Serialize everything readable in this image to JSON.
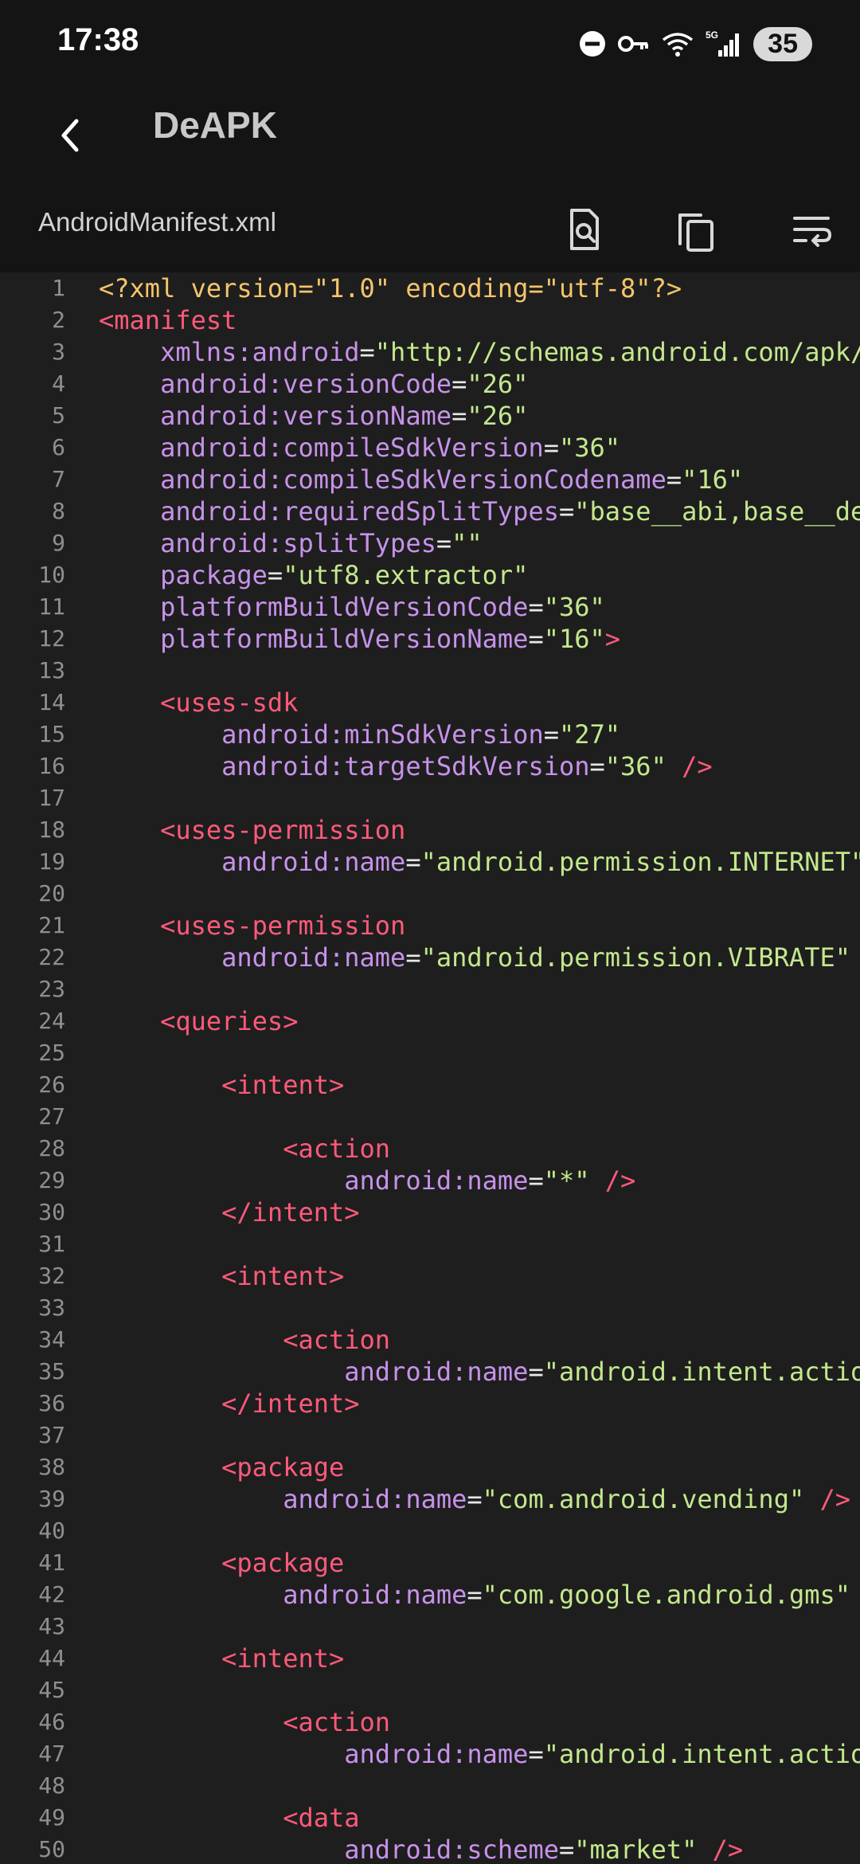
{
  "status_bar": {
    "time": "17:38",
    "battery": "35"
  },
  "app_bar": {
    "title": "DeAPK"
  },
  "file_bar": {
    "filename": "AndroidManifest.xml"
  },
  "icons": {
    "back": "back-arrow-icon",
    "search": "search-document-icon",
    "copy": "copy-icon",
    "wrap": "wrap-text-icon"
  },
  "colors": {
    "tag": "#ff5a7a",
    "attribute": "#c792ea",
    "value": "#c3e88d",
    "declaration": "#f5c56b",
    "line_number": "#8f8f8f"
  },
  "code": [
    {
      "n": "1",
      "segs": [
        [
          "decl",
          "<?xml version=\"1.0\" encoding=\"utf-8\"?>"
        ]
      ]
    },
    {
      "n": "2",
      "segs": [
        [
          "tag",
          "<manifest"
        ]
      ]
    },
    {
      "n": "3",
      "segs": [
        [
          "sp",
          "    "
        ],
        [
          "attr",
          "xmlns:android"
        ],
        [
          "eq",
          "="
        ],
        [
          "val",
          "\"http://schemas.android.com/apk/res/android\""
        ]
      ]
    },
    {
      "n": "4",
      "segs": [
        [
          "sp",
          "    "
        ],
        [
          "attr",
          "android:versionCode"
        ],
        [
          "eq",
          "="
        ],
        [
          "val",
          "\"26\""
        ]
      ]
    },
    {
      "n": "5",
      "segs": [
        [
          "sp",
          "    "
        ],
        [
          "attr",
          "android:versionName"
        ],
        [
          "eq",
          "="
        ],
        [
          "val",
          "\"26\""
        ]
      ]
    },
    {
      "n": "6",
      "segs": [
        [
          "sp",
          "    "
        ],
        [
          "attr",
          "android:compileSdkVersion"
        ],
        [
          "eq",
          "="
        ],
        [
          "val",
          "\"36\""
        ]
      ]
    },
    {
      "n": "7",
      "segs": [
        [
          "sp",
          "    "
        ],
        [
          "attr",
          "android:compileSdkVersionCodename"
        ],
        [
          "eq",
          "="
        ],
        [
          "val",
          "\"16\""
        ]
      ]
    },
    {
      "n": "8",
      "segs": [
        [
          "sp",
          "    "
        ],
        [
          "attr",
          "android:requiredSplitTypes"
        ],
        [
          "eq",
          "="
        ],
        [
          "val",
          "\"base__abi,base__density\""
        ]
      ]
    },
    {
      "n": "9",
      "segs": [
        [
          "sp",
          "    "
        ],
        [
          "attr",
          "android:splitTypes"
        ],
        [
          "eq",
          "="
        ],
        [
          "val",
          "\"\""
        ]
      ]
    },
    {
      "n": "10",
      "segs": [
        [
          "sp",
          "    "
        ],
        [
          "attr",
          "package"
        ],
        [
          "eq",
          "="
        ],
        [
          "val",
          "\"utf8.extractor\""
        ]
      ]
    },
    {
      "n": "11",
      "segs": [
        [
          "sp",
          "    "
        ],
        [
          "attr",
          "platformBuildVersionCode"
        ],
        [
          "eq",
          "="
        ],
        [
          "val",
          "\"36\""
        ]
      ]
    },
    {
      "n": "12",
      "segs": [
        [
          "sp",
          "    "
        ],
        [
          "attr",
          "platformBuildVersionName"
        ],
        [
          "eq",
          "="
        ],
        [
          "val",
          "\"16\""
        ],
        [
          "tag",
          ">"
        ]
      ]
    },
    {
      "n": "13",
      "segs": []
    },
    {
      "n": "14",
      "segs": [
        [
          "sp",
          "    "
        ],
        [
          "tag",
          "<uses-sdk"
        ]
      ]
    },
    {
      "n": "15",
      "segs": [
        [
          "sp",
          "        "
        ],
        [
          "attr",
          "android:minSdkVersion"
        ],
        [
          "eq",
          "="
        ],
        [
          "val",
          "\"27\""
        ]
      ]
    },
    {
      "n": "16",
      "segs": [
        [
          "sp",
          "        "
        ],
        [
          "attr",
          "android:targetSdkVersion"
        ],
        [
          "eq",
          "="
        ],
        [
          "val",
          "\"36\""
        ],
        [
          "tag",
          " />"
        ]
      ]
    },
    {
      "n": "17",
      "segs": []
    },
    {
      "n": "18",
      "segs": [
        [
          "sp",
          "    "
        ],
        [
          "tag",
          "<uses-permission"
        ]
      ]
    },
    {
      "n": "19",
      "segs": [
        [
          "sp",
          "        "
        ],
        [
          "attr",
          "android:name"
        ],
        [
          "eq",
          "="
        ],
        [
          "val",
          "\"android.permission.INTERNET\""
        ],
        [
          "tag",
          " />"
        ]
      ]
    },
    {
      "n": "20",
      "segs": []
    },
    {
      "n": "21",
      "segs": [
        [
          "sp",
          "    "
        ],
        [
          "tag",
          "<uses-permission"
        ]
      ]
    },
    {
      "n": "22",
      "segs": [
        [
          "sp",
          "        "
        ],
        [
          "attr",
          "android:name"
        ],
        [
          "eq",
          "="
        ],
        [
          "val",
          "\"android.permission.VIBRATE\""
        ],
        [
          "tag",
          " />"
        ]
      ]
    },
    {
      "n": "23",
      "segs": []
    },
    {
      "n": "24",
      "segs": [
        [
          "sp",
          "    "
        ],
        [
          "tag",
          "<queries>"
        ]
      ]
    },
    {
      "n": "25",
      "segs": []
    },
    {
      "n": "26",
      "segs": [
        [
          "sp",
          "        "
        ],
        [
          "tag",
          "<intent>"
        ]
      ]
    },
    {
      "n": "27",
      "segs": []
    },
    {
      "n": "28",
      "segs": [
        [
          "sp",
          "            "
        ],
        [
          "tag",
          "<action"
        ]
      ]
    },
    {
      "n": "29",
      "segs": [
        [
          "sp",
          "                "
        ],
        [
          "attr",
          "android:name"
        ],
        [
          "eq",
          "="
        ],
        [
          "val",
          "\"*\""
        ],
        [
          "tag",
          " />"
        ]
      ]
    },
    {
      "n": "30",
      "segs": [
        [
          "sp",
          "        "
        ],
        [
          "tag",
          "</intent>"
        ]
      ]
    },
    {
      "n": "31",
      "segs": []
    },
    {
      "n": "32",
      "segs": [
        [
          "sp",
          "        "
        ],
        [
          "tag",
          "<intent>"
        ]
      ]
    },
    {
      "n": "33",
      "segs": []
    },
    {
      "n": "34",
      "segs": [
        [
          "sp",
          "            "
        ],
        [
          "tag",
          "<action"
        ]
      ]
    },
    {
      "n": "35",
      "segs": [
        [
          "sp",
          "                "
        ],
        [
          "attr",
          "android:name"
        ],
        [
          "eq",
          "="
        ],
        [
          "val",
          "\"android.intent.action.MAIN\""
        ],
        [
          "tag",
          " />"
        ]
      ]
    },
    {
      "n": "36",
      "segs": [
        [
          "sp",
          "        "
        ],
        [
          "tag",
          "</intent>"
        ]
      ]
    },
    {
      "n": "37",
      "segs": []
    },
    {
      "n": "38",
      "segs": [
        [
          "sp",
          "        "
        ],
        [
          "tag",
          "<package"
        ]
      ]
    },
    {
      "n": "39",
      "segs": [
        [
          "sp",
          "            "
        ],
        [
          "attr",
          "android:name"
        ],
        [
          "eq",
          "="
        ],
        [
          "val",
          "\"com.android.vending\""
        ],
        [
          "tag",
          " />"
        ]
      ]
    },
    {
      "n": "40",
      "segs": []
    },
    {
      "n": "41",
      "segs": [
        [
          "sp",
          "        "
        ],
        [
          "tag",
          "<package"
        ]
      ]
    },
    {
      "n": "42",
      "segs": [
        [
          "sp",
          "            "
        ],
        [
          "attr",
          "android:name"
        ],
        [
          "eq",
          "="
        ],
        [
          "val",
          "\"com.google.android.gms\""
        ],
        [
          "tag",
          " />"
        ]
      ]
    },
    {
      "n": "43",
      "segs": []
    },
    {
      "n": "44",
      "segs": [
        [
          "sp",
          "        "
        ],
        [
          "tag",
          "<intent>"
        ]
      ]
    },
    {
      "n": "45",
      "segs": []
    },
    {
      "n": "46",
      "segs": [
        [
          "sp",
          "            "
        ],
        [
          "tag",
          "<action"
        ]
      ]
    },
    {
      "n": "47",
      "segs": [
        [
          "sp",
          "                "
        ],
        [
          "attr",
          "android:name"
        ],
        [
          "eq",
          "="
        ],
        [
          "val",
          "\"android.intent.action.VIEW\""
        ],
        [
          "tag",
          " />"
        ]
      ]
    },
    {
      "n": "48",
      "segs": []
    },
    {
      "n": "49",
      "segs": [
        [
          "sp",
          "            "
        ],
        [
          "tag",
          "<data"
        ]
      ]
    },
    {
      "n": "50",
      "segs": [
        [
          "sp",
          "                "
        ],
        [
          "attr",
          "android:scheme"
        ],
        [
          "eq",
          "="
        ],
        [
          "val",
          "\"market\""
        ],
        [
          "tag",
          " />"
        ]
      ]
    }
  ]
}
